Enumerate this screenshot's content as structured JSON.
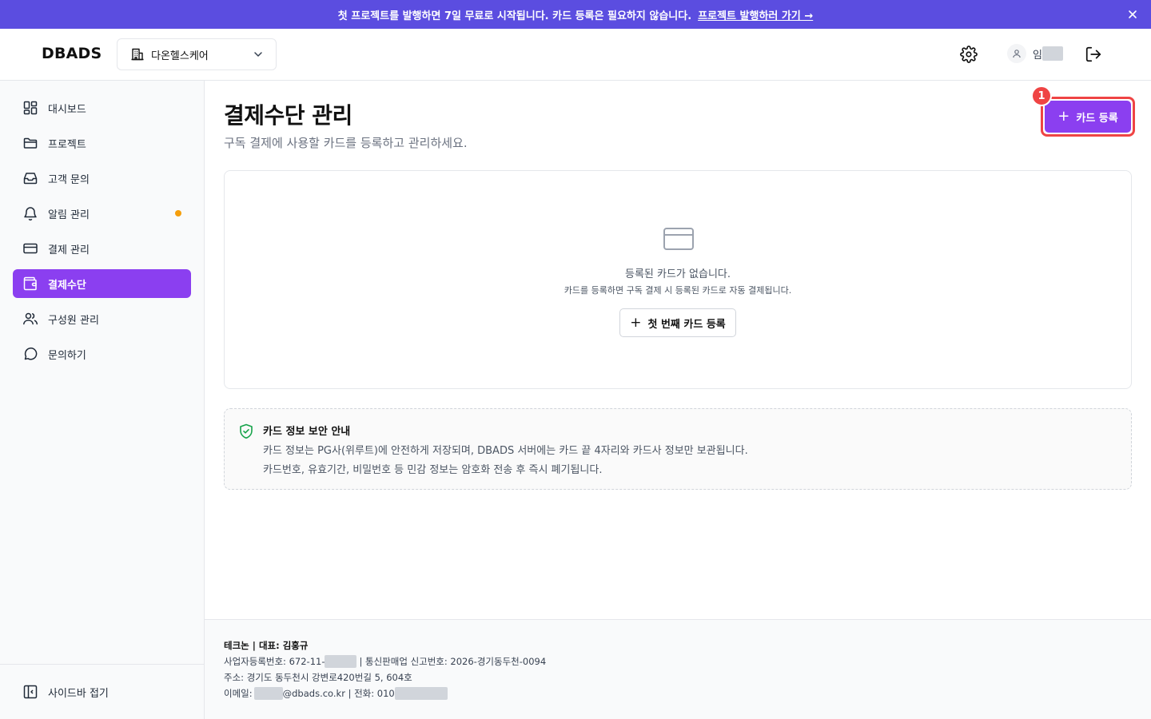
{
  "banner": {
    "text": "첫 프로젝트를 발행하면 7일 무료로 시작됩니다. 카드 등록은 필요하지 않습니다.",
    "link": "프로젝트 발행하러 가기 →",
    "close_icon": "close-icon"
  },
  "header": {
    "logo": "DBADS",
    "org_name": "다온헬스케어",
    "user_name": "임"
  },
  "sidebar": {
    "items": [
      {
        "label": "대시보드",
        "icon": "dashboard-icon"
      },
      {
        "label": "프로젝트",
        "icon": "folder-icon"
      },
      {
        "label": "고객 문의",
        "icon": "inbox-icon"
      },
      {
        "label": "알림 관리",
        "icon": "bell-icon",
        "dot": true
      },
      {
        "label": "결제 관리",
        "icon": "credit-card-icon"
      },
      {
        "label": "결제수단",
        "icon": "wallet-icon",
        "active": true
      },
      {
        "label": "구성원 관리",
        "icon": "users-icon"
      },
      {
        "label": "문의하기",
        "icon": "chat-icon"
      }
    ],
    "collapse_label": "사이드바 접기"
  },
  "main": {
    "title": "결제수단 관리",
    "subtitle": "구독 결제에 사용할 카드를 등록하고 관리하세요.",
    "add_button": "카드 등록",
    "badge": "1",
    "empty": {
      "title": "등록된 카드가 없습니다.",
      "desc": "카드를 등록하면 구독 결제 시 등록된 카드로 자동 결제됩니다.",
      "button": "첫 번째 카드 등록"
    },
    "security": {
      "title": "카드 정보 보안 안내",
      "line1": "카드 정보는 PG사(위루트)에 안전하게 저장되며, DBADS 서버에는 카드 끝 4자리와 카드사 정보만 보관됩니다.",
      "line2": "카드번호, 유효기간, 비밀번호 등 민감 정보는 암호화 전송 후 즉시 폐기됩니다."
    }
  },
  "footer": {
    "company": "테크논 | 대표: 김홍규",
    "biz_prefix": "사업자등록번호: 672-11-",
    "biz_suffix": "| 통신판매업 신고번호: 2026-경기동두천-0094",
    "address": "주소: 경기도 동두천시 강변로420번길 5, 604호",
    "email_prefix": "이메일:",
    "email_domain": "@dbads.co.kr | 전화: 010"
  }
}
